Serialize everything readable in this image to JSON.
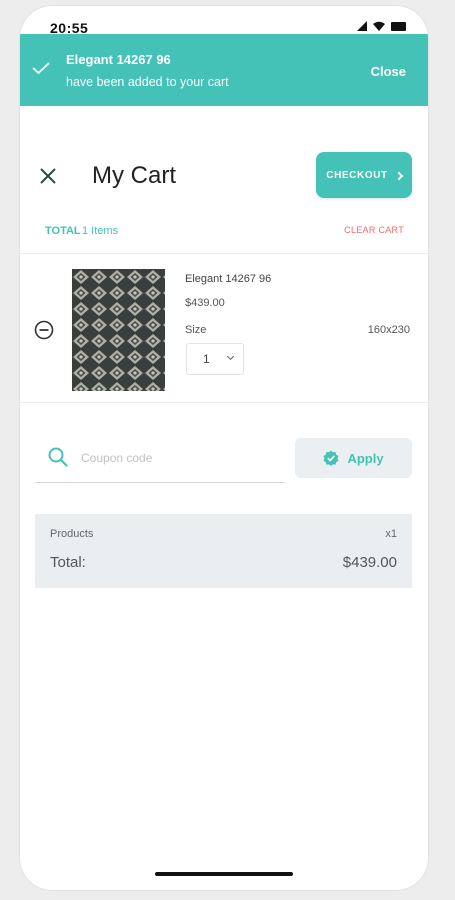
{
  "status_bar": {
    "time": "20:55"
  },
  "toast": {
    "title": "Elegant 14267 96",
    "message": "have been added to your cart",
    "close_label": "Close",
    "icon": "checkmark-icon",
    "color": "#45c2b8"
  },
  "header": {
    "title": "My Cart",
    "checkout_label": "CHECKOUT",
    "close_icon": "close-icon"
  },
  "summary_bar": {
    "total_label": "TOTAL",
    "items_label": "1 Items",
    "clear_label": "CLEAR CART"
  },
  "cart_items": [
    {
      "name": "Elegant 14267 96",
      "price": "$439.00",
      "size_label": "Size",
      "size_value": "160x230",
      "quantity": "1"
    }
  ],
  "coupon": {
    "placeholder": "Coupon code",
    "apply_label": "Apply"
  },
  "totals": {
    "products_label": "Products",
    "products_count": "x1",
    "total_label": "Total:",
    "total_value": "$439.00"
  },
  "colors": {
    "accent": "#45c2b8",
    "danger": "#f06a6a",
    "summary_bg": "#ebeef0"
  }
}
